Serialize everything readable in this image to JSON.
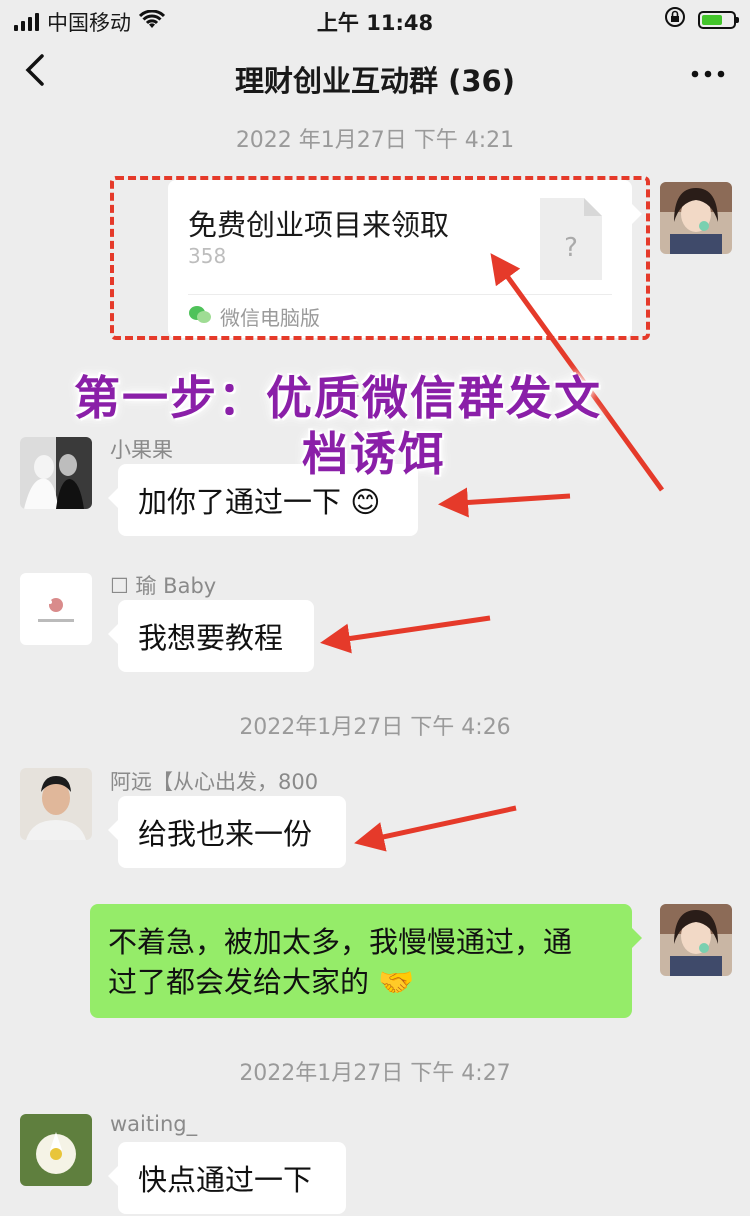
{
  "status_bar": {
    "carrier": "中国移动",
    "time": "上午 11:48"
  },
  "nav": {
    "title": "理财创业互动群 (36)",
    "back_icon": "chevron-left-icon",
    "more_icon": "more-dots-icon"
  },
  "timestamps": [
    "2022 年1月27日 下午 4:21",
    "2022年1月27日 下午 4:26",
    "2022年1月27日 下午 4:27"
  ],
  "file_message": {
    "name": "免费创业项目来领取",
    "size": "358",
    "source": "微信电脑版"
  },
  "annotation": {
    "line1": "第一步：优质微信群发文",
    "line2": "档诱饵",
    "color": "#8a1fa8",
    "arrow_color": "#e53a2a"
  },
  "messages": [
    {
      "sender": "小果果",
      "text": "加你了通过一下 😊"
    },
    {
      "sender": "☐ 瑜 Baby",
      "text": "我想要教程"
    },
    {
      "sender": "阿远【从心出发，800",
      "text": "给我也来一份"
    },
    {
      "sender": "",
      "text_line1": "不着急，被加太多，我慢慢通过，通",
      "text_line2": "过了都会发给大家的 🤝"
    },
    {
      "sender": "waiting_",
      "text": "快点通过一下"
    }
  ],
  "colors": {
    "background": "#ededed",
    "self_bubble": "#95ec69",
    "other_bubble": "#ffffff"
  }
}
